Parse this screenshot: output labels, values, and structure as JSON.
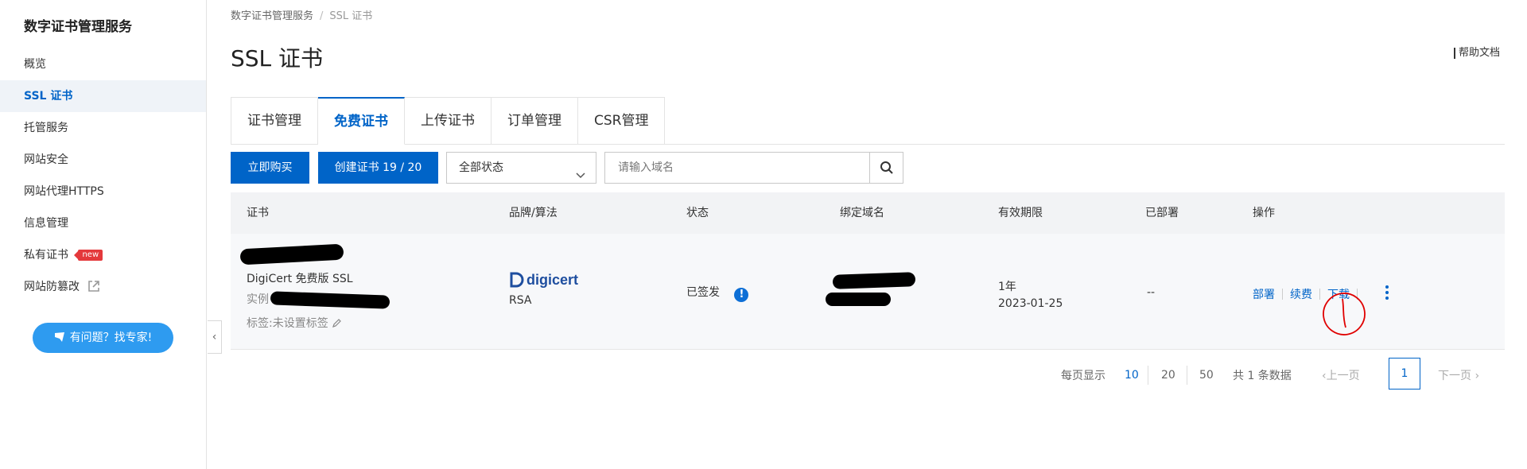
{
  "sidebar": {
    "title": "数字证书管理服务",
    "items": [
      {
        "label": "概览"
      },
      {
        "label": "SSL 证书"
      },
      {
        "label": "托管服务"
      },
      {
        "label": "网站安全"
      },
      {
        "label": "网站代理HTTPS"
      },
      {
        "label": "信息管理"
      },
      {
        "label": "私有证书",
        "badge": "new"
      },
      {
        "label": "网站防篡改"
      }
    ],
    "help_button": "有问题？找专家!"
  },
  "breadcrumb": {
    "root": "数字证书管理服务",
    "separator": "/",
    "current": "SSL 证书"
  },
  "page": {
    "title": "SSL 证书",
    "help_doc": "帮助文档"
  },
  "tabs": [
    {
      "label": "证书管理"
    },
    {
      "label": "免费证书"
    },
    {
      "label": "上传证书"
    },
    {
      "label": "订单管理"
    },
    {
      "label": "CSR管理"
    }
  ],
  "toolbar": {
    "buy_now": "立即购买",
    "create_cert": "创建证书 19 / 20",
    "status_filter": "全部状态",
    "search_placeholder": "请输入域名"
  },
  "table": {
    "columns": [
      "证书",
      "品牌/算法",
      "状态",
      "绑定域名",
      "有效期限",
      "已部署",
      "操作"
    ],
    "rows": [
      {
        "cert_type": "DigiCert 免费版 SSL",
        "instance_label": "实例",
        "tag_label": "标签:未设置标签",
        "brand": "digicert",
        "algorithm": "RSA",
        "status": "已签发",
        "validity": "1年",
        "expiry": "2023-01-25",
        "deployed": "--",
        "actions": [
          "部署",
          "续费",
          "下载"
        ]
      }
    ]
  },
  "pagination": {
    "per_page_label": "每页显示",
    "sizes": [
      "10",
      "20",
      "50"
    ],
    "active_size": "10",
    "total": "共 1 条数据",
    "prev": "上一页",
    "current_page": "1",
    "next": "下一页"
  },
  "colors": {
    "primary": "#0064c8",
    "sidebar_active_bg": "#eff3f8",
    "help_button": "#2e9bf0",
    "badge": "#e4393c",
    "annotation": "#e00000"
  }
}
